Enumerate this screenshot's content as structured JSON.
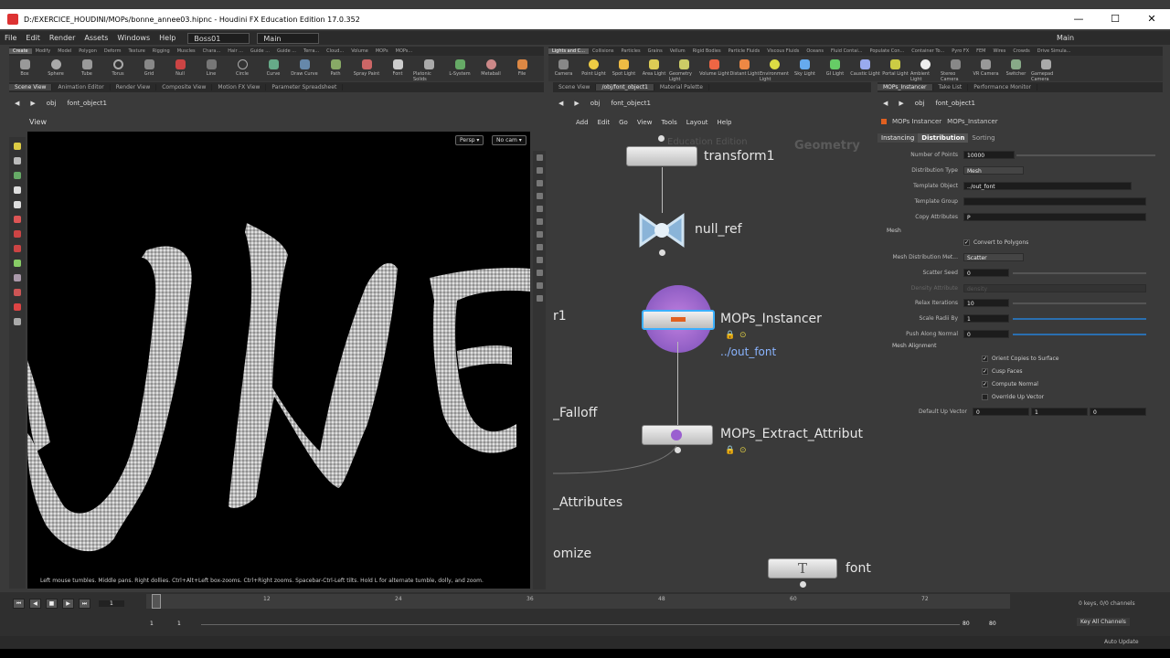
{
  "titlebar": {
    "title": "D:/EXERCICE_HOUDINI/MOPs/bonne_annee03.hipnc - Houdini FX Education Edition 17.0.352",
    "min": "—",
    "max": "☐",
    "close": "✕"
  },
  "menu": {
    "items": [
      "File",
      "Edit",
      "Render",
      "Assets",
      "Windows",
      "Help"
    ],
    "desktop1": "Boss01",
    "desktop2": "Main",
    "desktop_right": "Main"
  },
  "shelf_left": {
    "tabs": [
      "Create",
      "Modify",
      "Model",
      "Polygon",
      "Deform",
      "Texture",
      "Rigging",
      "Muscles",
      "Chara...",
      "Hair ...",
      "Guide ...",
      "Guide ...",
      "Terra...",
      "Cloud...",
      "Volume",
      "MOPs",
      "MOPs..."
    ],
    "tools": [
      "Box",
      "Sphere",
      "Tube",
      "Torus",
      "Grid",
      "Null",
      "Line",
      "Circle",
      "Curve",
      "Draw Curve",
      "Path",
      "Spray Paint",
      "Font",
      "Platonic Solids",
      "L-System",
      "Metaball",
      "File"
    ]
  },
  "shelf_right": {
    "tabs": [
      "Lights and C...",
      "Collisions",
      "Particles",
      "Grains",
      "Vellum",
      "Rigid Bodies",
      "Particle Fluids",
      "Viscous Fluids",
      "Oceans",
      "Fluid Contai...",
      "Populate Con...",
      "Container To...",
      "Pyro FX",
      "FEM",
      "Wires",
      "Crowds",
      "Drive Simula..."
    ],
    "tools": [
      "Camera",
      "Point Light",
      "Spot Light",
      "Area Light",
      "Geometry Light",
      "Volume Light",
      "Distant Light",
      "Environment Light",
      "Sky Light",
      "GI Light",
      "Caustic Light",
      "Portal Light",
      "Ambient Light",
      "Stereo Camera",
      "VR Camera",
      "Switcher",
      "Gamepad Camera"
    ]
  },
  "scene_tabs": [
    "Scene View",
    "Animation Editor",
    "Render View",
    "Composite View",
    "Motion FX View",
    "Parameter Spreadsheet"
  ],
  "scene_path": {
    "obj": "obj",
    "node": "font_object1"
  },
  "viewport": {
    "label": "View",
    "persp": "Persp ▾",
    "cam": "No cam ▾",
    "hint": "Left mouse tumbles. Middle pans. Right dollies. Ctrl+Alt+Left box-zooms. Ctrl+Right zooms. Spacebar-Ctrl-Left tilts. Hold L for alternate tumble, dolly, and zoom."
  },
  "network": {
    "tabs": [
      "Scene View",
      "/obj/font_object1",
      "Material Palette"
    ],
    "path_obj": "obj",
    "path_node": "font_object1",
    "menu": [
      "Add",
      "Edit",
      "Go",
      "View",
      "Tools",
      "Layout",
      "Help"
    ],
    "watermark1": "Education Edition",
    "watermark2": "Geometry",
    "nodes": {
      "transform": "transform1",
      "null": "null_ref",
      "instancer": "MOPs_Instancer",
      "instancer_sub": "../out_font",
      "extract": "MOPs_Extract_Attribut",
      "font": "font",
      "left1": "r1",
      "left2": "_Falloff",
      "left3": "_Attributes",
      "left4": "omize"
    }
  },
  "params": {
    "tabs": [
      "MOPs_Instancer",
      "Take List",
      "Performance Monitor"
    ],
    "path_obj": "obj",
    "path_node": "font_object1",
    "node_type": "MOPs Instancer",
    "node_name": "MOPs_Instancer",
    "ptabs": [
      "Instancing",
      "Distribution",
      "Sorting"
    ],
    "rows": {
      "num_points_label": "Number of Points",
      "num_points": "10000",
      "dist_type_label": "Distribution Type",
      "dist_type": "Mesh",
      "template_obj_label": "Template Object",
      "template_obj": "../out_font",
      "template_group_label": "Template Group",
      "template_group": "",
      "copy_attr_label": "Copy Attributes",
      "copy_attr": "P",
      "mesh_section": "Mesh",
      "convert_label": "Convert to Polygons",
      "mesh_method_label": "Mesh Distribution Met...",
      "mesh_method": "Scatter",
      "seed_label": "Scatter Seed",
      "seed": "0",
      "density_label": "Density Attribute",
      "density": "density",
      "relax_label": "Relax Iterations",
      "relax": "10",
      "scale_radii_label": "Scale Radii By",
      "scale_radii": "1",
      "push_label": "Push Along Normal",
      "push": "0",
      "align_section": "Mesh Alignment",
      "orient_label": "Orient Copies to Surface",
      "cusp_label": "Cusp Faces",
      "compute_label": "Compute Normal",
      "override_label": "Override Up Vector",
      "up_label": "Default Up Vector",
      "up_x": "0",
      "up_y": "1",
      "up_z": "0"
    }
  },
  "timeline": {
    "frame": "1",
    "start": "1",
    "start2": "1",
    "end": "80",
    "end2": "80",
    "keys": "0 keys, 0/0 channels",
    "key_all": "Key All Channels",
    "auto": "Auto Update",
    "ticks": [
      "12",
      "24",
      "36",
      "48",
      "60",
      "72"
    ]
  }
}
